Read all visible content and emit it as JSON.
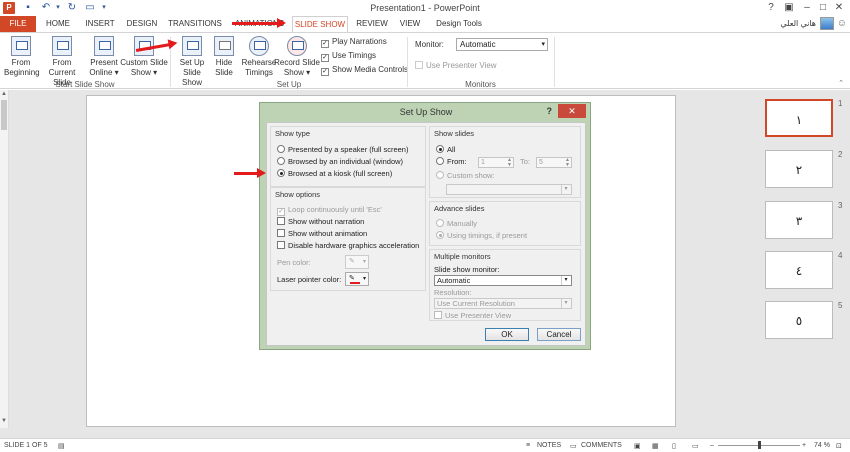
{
  "window": {
    "title": "Presentation1 - PowerPoint",
    "user_name": "هاني العلي",
    "app_logo_letter": "P"
  },
  "tabs": [
    "FILE",
    "HOME",
    "INSERT",
    "DESIGN",
    "TRANSITIONS",
    "ANIMATIONS",
    "SLIDE SHOW",
    "REVIEW",
    "VIEW",
    "Design Tools"
  ],
  "active_tab": "SLIDE SHOW",
  "ribbon": {
    "start_group": {
      "label": "Start Slide Show",
      "from_beginning": [
        "From",
        "Beginning"
      ],
      "from_current": [
        "From",
        "Current Slide"
      ],
      "present_online": [
        "Present",
        "Online ▾"
      ],
      "custom_show": [
        "Custom Slide",
        "Show ▾"
      ]
    },
    "setup_group": {
      "label": "Set Up",
      "setup_show": [
        "Set Up",
        "Slide Show"
      ],
      "hide_slide": [
        "Hide",
        "Slide"
      ],
      "rehearse": [
        "Rehearse",
        "Timings"
      ],
      "record": [
        "Record Slide",
        "Show ▾"
      ],
      "play_narrations": "Play Narrations",
      "use_timings": "Use Timings",
      "show_media_controls": "Show Media Controls"
    },
    "monitors_group": {
      "label": "Monitors",
      "monitor_label": "Monitor:",
      "monitor_value": "Automatic",
      "use_presenter_view": "Use Presenter View"
    }
  },
  "thumbnails": [
    {
      "num": "1",
      "text": "١"
    },
    {
      "num": "2",
      "text": "٢"
    },
    {
      "num": "3",
      "text": "٣"
    },
    {
      "num": "4",
      "text": "٤"
    },
    {
      "num": "5",
      "text": "٥"
    }
  ],
  "statusbar": {
    "slide_info": "SLIDE 1 OF 5",
    "notes": "NOTES",
    "comments": "COMMENTS",
    "zoom": "74 %"
  },
  "dialog": {
    "title": "Set Up Show",
    "help": "?",
    "close": "✕",
    "show_type": {
      "title": "Show type",
      "options": [
        "Presented by a speaker (full screen)",
        "Browsed by an individual (window)",
        "Browsed at a kiosk (full screen)"
      ],
      "selected": 2
    },
    "show_options": {
      "title": "Show options",
      "loop": "Loop continuously until 'Esc'",
      "without_narration": "Show without narration",
      "without_animation": "Show without animation",
      "disable_hw": "Disable hardware graphics acceleration",
      "pen_color": "Pen color:",
      "laser_color": "Laser pointer color:"
    },
    "show_slides": {
      "title": "Show slides",
      "all": "All",
      "from": "From:",
      "from_value": "1",
      "to": "To:",
      "to_value": "5",
      "custom_show": "Custom show:"
    },
    "advance": {
      "title": "Advance slides",
      "manually": "Manually",
      "using_timings": "Using timings, if present"
    },
    "monitors": {
      "title": "Multiple monitors",
      "slide_show_monitor": "Slide show monitor:",
      "monitor_value": "Automatic",
      "resolution": "Resolution:",
      "resolution_value": "Use Current Resolution",
      "use_presenter_view": "Use Presenter View"
    },
    "ok": "OK",
    "cancel": "Cancel"
  },
  "colors": {
    "accent": "#d24726",
    "annotation_arrow": "#e31b1b",
    "dialog_frame": "#bdd3b3"
  }
}
